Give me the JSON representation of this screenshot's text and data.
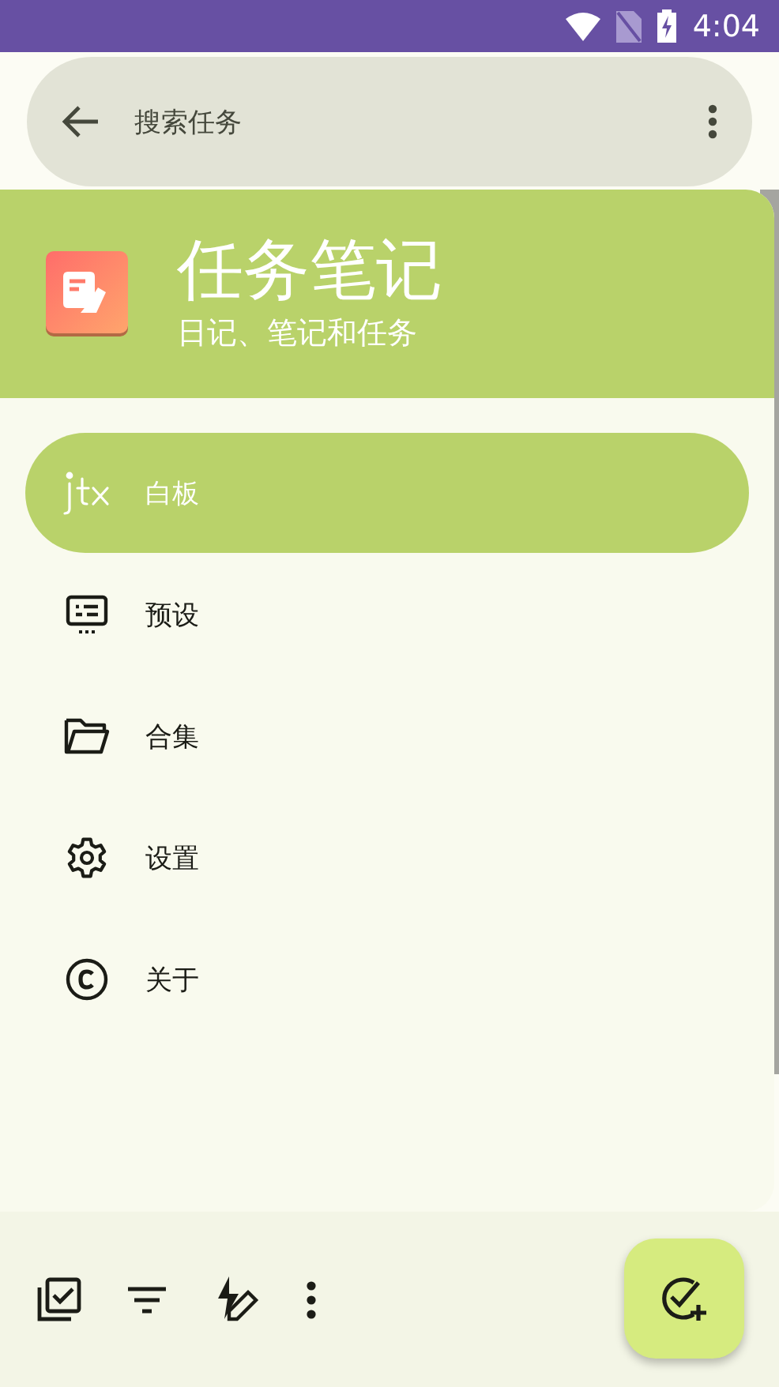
{
  "status_bar": {
    "time": "4:04"
  },
  "search": {
    "placeholder": "搜索任务"
  },
  "drawer": {
    "title": "任务笔记",
    "subtitle": "日记、笔记和任务",
    "items": [
      {
        "label": "白板",
        "selected": true
      },
      {
        "label": "预设",
        "selected": false
      },
      {
        "label": "合集",
        "selected": false
      },
      {
        "label": "设置",
        "selected": false
      },
      {
        "label": "关于",
        "selected": false
      }
    ]
  }
}
